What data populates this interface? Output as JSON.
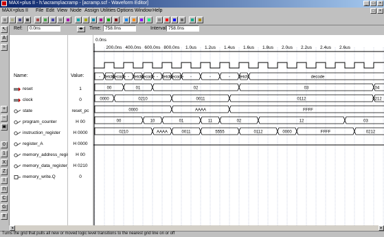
{
  "window": {
    "title": "MAX+plus II - h:\\acramp\\acramp - [acramp.scf - Waveform Editor]"
  },
  "menu": [
    "MAX+plus II",
    "File",
    "Edit",
    "View",
    "Node",
    "Assign",
    "Utilities",
    "Options",
    "Window",
    "Help"
  ],
  "controls": {
    "ref_label": "Ref:",
    "ref_value": "0.0ns",
    "time_label": "Time:",
    "time_value": "758.0ns",
    "interval_label": "Interval:",
    "interval_value": "758.0ns"
  },
  "headers": {
    "name": "Name:",
    "value": "Value:",
    "start_time": "0.0ns"
  },
  "time_ticks": [
    "200.0ns",
    "400.0ns",
    "600.0ns",
    "800.0ns",
    "1.0us",
    "1.2us",
    "1.4us",
    "1.6us",
    "1.8us",
    "2.0us",
    "2.2us",
    "2.4us",
    "2.6us"
  ],
  "signals": [
    {
      "name": "reset",
      "value": "1",
      "icon": "input-pin-icon"
    },
    {
      "name": "clock",
      "value": "0",
      "icon": "input-pin-icon"
    },
    {
      "name": "state",
      "value": "reset_pc",
      "icon": "buried-node-icon"
    },
    {
      "name": "program_counter",
      "value": "H 00",
      "icon": "buried-node-icon"
    },
    {
      "name": "instruction_register",
      "value": "H 0000",
      "icon": "buried-node-icon"
    },
    {
      "name": "register_A",
      "value": "H 0000",
      "icon": "buried-node-icon"
    },
    {
      "name": "memory_address_register",
      "value": "H 00",
      "icon": "buried-node-icon"
    },
    {
      "name": "memory_data_register_out",
      "value": "H 0210",
      "icon": "buried-node-icon"
    },
    {
      "name": "memory_write.Q",
      "value": "0",
      "icon": "register-icon"
    }
  ],
  "wave_labels": {
    "state": [
      "-",
      "fetch",
      "decode",
      "-",
      "fetch",
      "decode",
      "-",
      "fetch",
      "decode",
      "-",
      "-",
      "-",
      "fetch",
      "decode"
    ],
    "program_counter": [
      "00",
      "01",
      "02",
      "03",
      "04"
    ],
    "instruction_register": [
      "0000",
      "0210",
      "0011",
      "0112",
      "0212"
    ],
    "register_A": [
      "0000",
      "AAAA",
      "FFFF"
    ],
    "memory_address_register": [
      "00",
      "10",
      "01",
      "11",
      "02",
      "12",
      "03"
    ],
    "memory_data_register_out": [
      "0210",
      "AAAA",
      "0011",
      "5555",
      "0112",
      "0000",
      "FFFF",
      "0212"
    ]
  },
  "status": "Turns the grid that pulls all new or moved logic level transitions to the nearest grid line on or off",
  "colors": {
    "title_start": "#0a246a",
    "title_end": "#a6caf0",
    "grid": "#9fa8c8",
    "wave": "#000000",
    "highlight": "#000080"
  }
}
